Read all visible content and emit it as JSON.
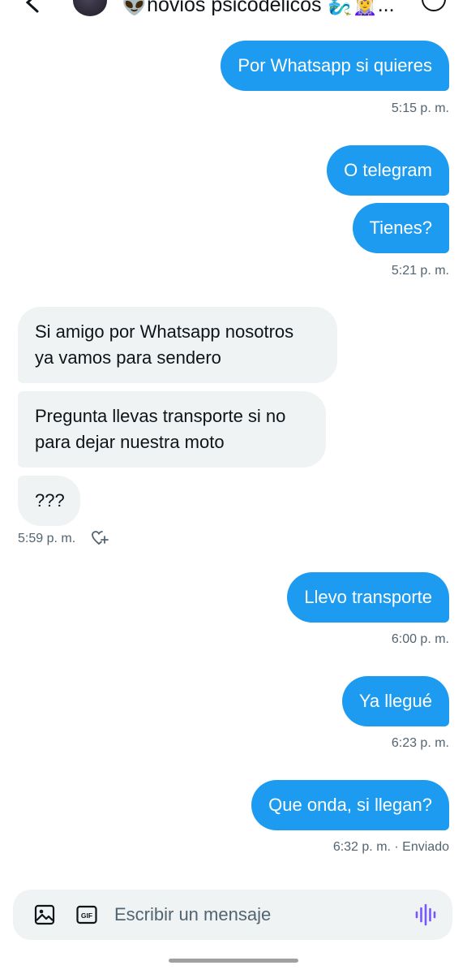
{
  "header": {
    "title": "👽novios psicodelicos 🧞‍♂️🧝‍♀️..."
  },
  "messages": [
    {
      "text": "Por Whatsapp si quieres",
      "time": "5:15 p. m."
    },
    {
      "text": "O telegram"
    },
    {
      "text": "Tienes?",
      "time": "5:21 p. m."
    },
    {
      "text": "Si amigo por Whatsapp nosotros",
      "text2": "ya vamos para sendero"
    },
    {
      "text": "Pregunta llevas transporte si no",
      "text2": "para dejar nuestra moto"
    },
    {
      "text": "???",
      "time": "5:59 p. m."
    },
    {
      "text": "Llevo transporte",
      "time": "6:00 p. m."
    },
    {
      "text": "Ya llegué",
      "time": "6:23 p. m."
    },
    {
      "text": "Que onda, si llegan?",
      "time": "6:32 p. m. · Enviado"
    }
  ],
  "composer": {
    "placeholder": "Escribir un mensaje"
  },
  "colors": {
    "accent": "#1d9bf0",
    "incoming_bubble": "#eff3f4",
    "voice": "#7856ff"
  },
  "icons": [
    "back-arrow-icon",
    "info-icon",
    "add-reaction-icon",
    "image-icon",
    "gif-icon",
    "voice-message-icon"
  ]
}
